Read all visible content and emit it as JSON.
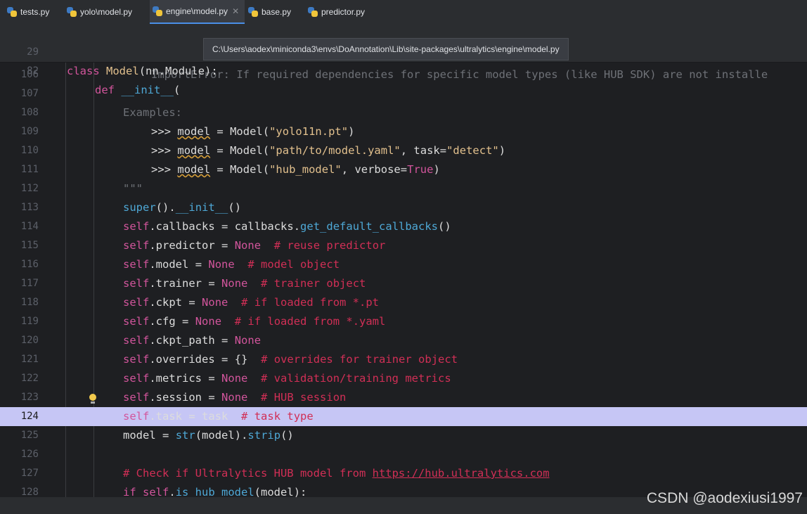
{
  "tabs": [
    {
      "label": "tests.py",
      "active": false
    },
    {
      "label": "yolo\\model.py",
      "active": false
    },
    {
      "label": "engine\\model.py",
      "active": true
    },
    {
      "label": "base.py",
      "active": false
    },
    {
      "label": "predictor.py",
      "active": false
    }
  ],
  "sticky": {
    "line29": {
      "num": "29",
      "text": "class Model(nn.Module):"
    },
    "line82": {
      "num": "82",
      "text": "def __init__("
    }
  },
  "tooltip": "C:\\Users\\aodex\\miniconda3\\envs\\DoAnnotation\\Lib\\site-packages\\ultralytics\\engine\\model.py",
  "lines": [
    {
      "num": "106",
      "text": "ImportError: If required dependencies for specific model types (like HUB SDK) are not installe"
    },
    {
      "num": "107",
      "text": ""
    },
    {
      "num": "108",
      "text": "Examples:"
    },
    {
      "num": "109",
      "text": ">>> model = Model(\"yolo11n.pt\")"
    },
    {
      "num": "110",
      "text": ">>> model = Model(\"path/to/model.yaml\", task=\"detect\")"
    },
    {
      "num": "111",
      "text": ">>> model = Model(\"hub_model\", verbose=True)"
    },
    {
      "num": "112",
      "text": "\"\"\""
    },
    {
      "num": "113",
      "text": "super().__init__()"
    },
    {
      "num": "114",
      "text": "self.callbacks = callbacks.get_default_callbacks()"
    },
    {
      "num": "115",
      "text": "self.predictor = None  # reuse predictor"
    },
    {
      "num": "116",
      "text": "self.model = None  # model object"
    },
    {
      "num": "117",
      "text": "self.trainer = None  # trainer object"
    },
    {
      "num": "118",
      "text": "self.ckpt = None  # if loaded from *.pt"
    },
    {
      "num": "119",
      "text": "self.cfg = None  # if loaded from *.yaml"
    },
    {
      "num": "120",
      "text": "self.ckpt_path = None"
    },
    {
      "num": "121",
      "text": "self.overrides = {}  # overrides for trainer object"
    },
    {
      "num": "122",
      "text": "self.metrics = None  # validation/training metrics"
    },
    {
      "num": "123",
      "text": "self.session = None  # HUB session"
    },
    {
      "num": "124",
      "text": "self.task = task  # task type"
    },
    {
      "num": "125",
      "text": "model = str(model).strip()"
    },
    {
      "num": "126",
      "text": ""
    },
    {
      "num": "127",
      "text": "# Check if Ultralytics HUB model from https://hub.ultralytics.com"
    },
    {
      "num": "128",
      "text": "if self.is_hub_model(model):"
    }
  ],
  "watermark": "CSDN @aodexiusi1997",
  "colors": {
    "current_line": "#c6c6f5",
    "keyword": "#d2559c",
    "comment": "#d12f56",
    "function": "#4ea8d6",
    "string": "#e2c08d"
  }
}
